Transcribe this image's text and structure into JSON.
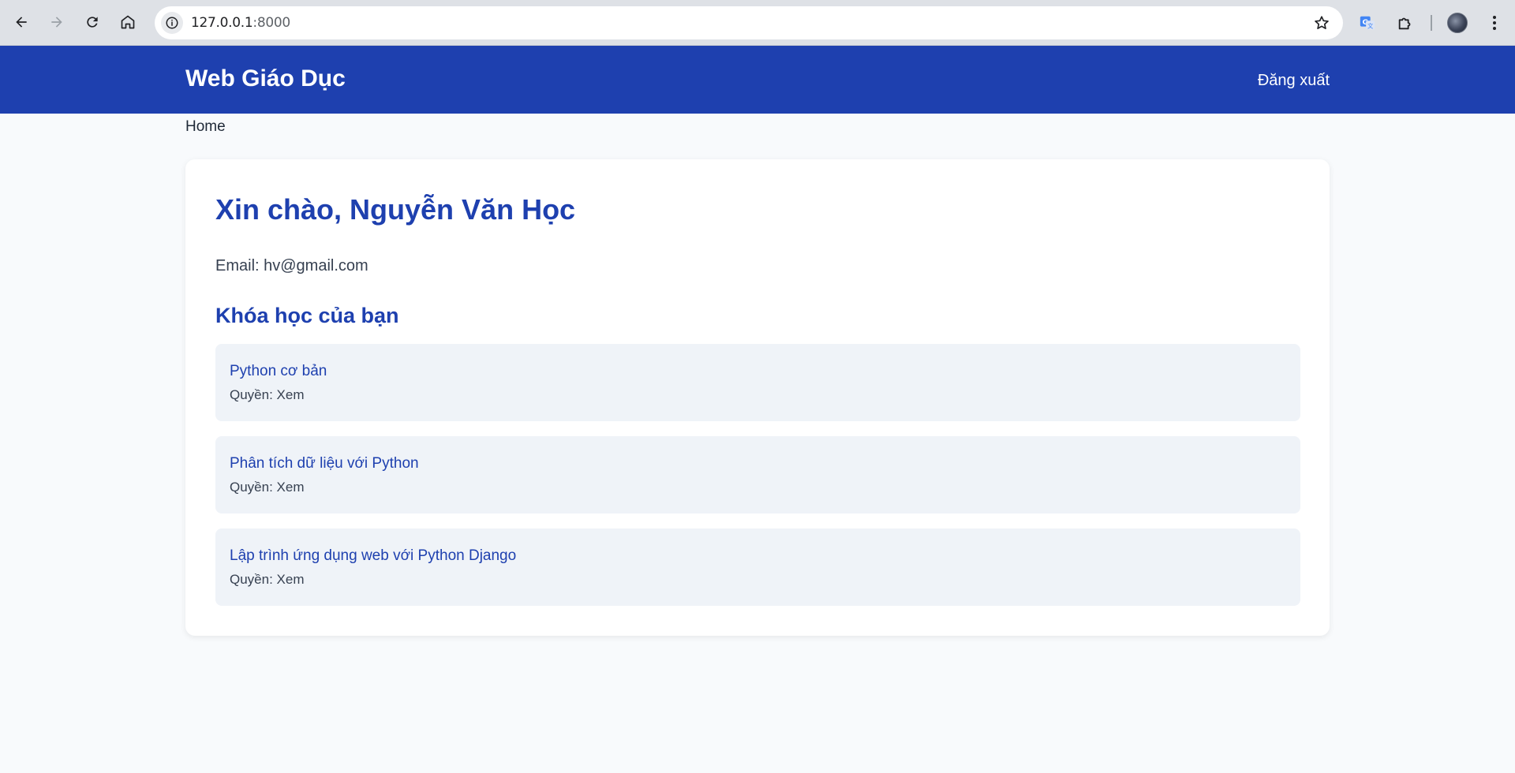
{
  "browser": {
    "url_host": "127.0.0.1",
    "url_port": ":8000"
  },
  "header": {
    "brand": "Web Giáo Dục",
    "logout_label": "Đăng xuất"
  },
  "breadcrumb": "Home",
  "profile": {
    "greeting": "Xin chào, Nguyễn Văn Học",
    "email": "Email: hv@gmail.com"
  },
  "courses": {
    "title": "Khóa học của bạn",
    "items": [
      {
        "name": "Python cơ bản",
        "permission": "Quyền: Xem"
      },
      {
        "name": "Phân tích dữ liệu với Python",
        "permission": "Quyền: Xem"
      },
      {
        "name": "Lập trình ứng dụng web với Python Django",
        "permission": "Quyền: Xem"
      }
    ]
  },
  "colors": {
    "primary": "#1e40af",
    "page_bg": "#f8fafc",
    "course_bg": "#eff3f8"
  }
}
